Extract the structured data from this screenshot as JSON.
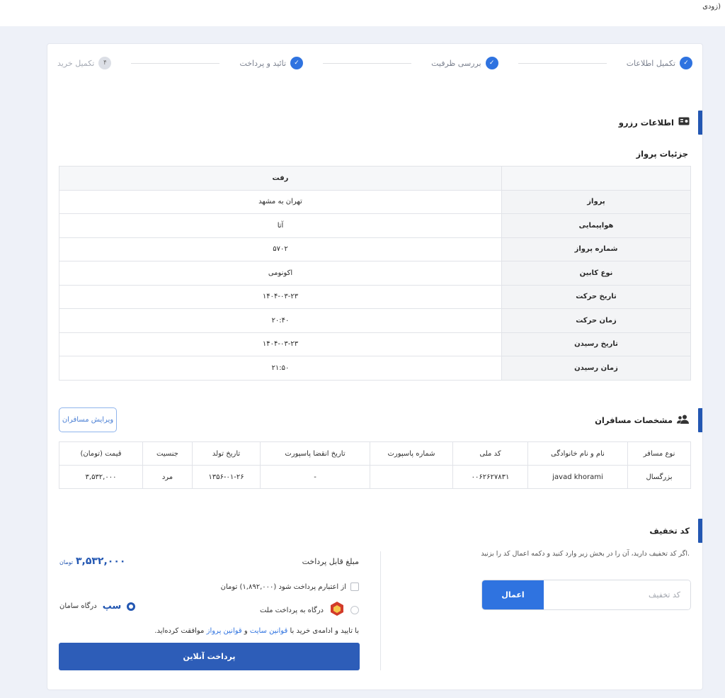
{
  "topbar": {
    "text": "زودی)"
  },
  "stepper": [
    {
      "label": "تکمیل اطلاعات",
      "mark": "✓",
      "state": "done"
    },
    {
      "label": "بررسی ظرفیت",
      "mark": "✓",
      "state": "done"
    },
    {
      "label": "تائید و پرداخت",
      "mark": "✓",
      "state": "done"
    },
    {
      "label": "تکمیل خرید",
      "mark": "۴",
      "state": "pending"
    }
  ],
  "reservation": {
    "title": "اطلاعات رزرو",
    "icon": "ticket-icon",
    "flight_details_title": "جزئیات پرواز",
    "column_header": "رفت",
    "rows": [
      {
        "label": "پرواز",
        "value": "تهران به مشهد"
      },
      {
        "label": "هواپیمایی",
        "value": "آتا"
      },
      {
        "label": "شماره پرواز",
        "value": "۵۷۰۲"
      },
      {
        "label": "نوع کابین",
        "value": "اکونومی"
      },
      {
        "label": "تاریخ حرکت",
        "value": "۱۴۰۴-۰۳-۲۳"
      },
      {
        "label": "زمان حرکت",
        "value": "۲۰:۴۰"
      },
      {
        "label": "تاریخ رسیدن",
        "value": "۱۴۰۴-۰۳-۲۳"
      },
      {
        "label": "زمان رسیدن",
        "value": "۲۱:۵۰"
      }
    ]
  },
  "passengers": {
    "title": "مشخصات مسافران",
    "icon": "users-icon",
    "edit_label": "ویرایش مسافران",
    "headers": [
      "نوع مسافر",
      "نام و نام خانوادگی",
      "کد ملی",
      "شماره پاسپورت",
      "تاریخ انقضا پاسپورت",
      "تاریخ تولد",
      "جنسیت",
      "قیمت (تومان)"
    ],
    "rows": [
      [
        "بزرگسال",
        "javad khorami",
        "۰۰۶۲۶۲۷۸۳۱",
        "",
        "-",
        "۱۳۵۶-۰۱-۲۶",
        "مرد",
        "۳,۵۳۲,۰۰۰"
      ]
    ]
  },
  "discount": {
    "title": "کد تخفیف",
    "description": "اگر کد تخفیف دارید، آن را در بخش زیر وارد کنید و دکمه اعمال کد را بزنید.",
    "placeholder": "کد تخفیف",
    "apply_label": "اعمال"
  },
  "payment": {
    "title": "مبلغ قابل پرداخت",
    "amount": "۳,۵۳۲,۰۰۰",
    "unit": "تومان",
    "credit_label": "از اعتبارم پرداخت شود (۱,۸۹۲,۰۰۰) تومان",
    "gateway_mellat": "درگاه به پرداخت ملت",
    "gateway_saman": "درگاه سامان",
    "saman_logo_text": "سپ",
    "agree_prefix": "با تایید و ادامه‌ی خرید با",
    "agree_link1": "قوانین سایت",
    "agree_and": "و",
    "agree_link2": "قوانین پرواز",
    "agree_suffix": "موافقت کرده‌اید.",
    "online_label": "پرداخت آنلاین"
  }
}
